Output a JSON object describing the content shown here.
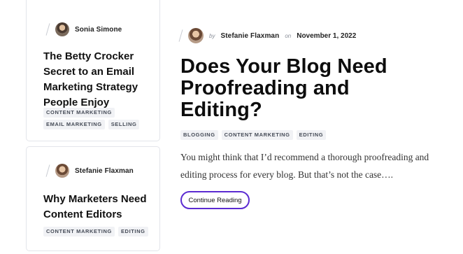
{
  "cards": [
    {
      "author": "Sonia Simone",
      "title": "The Betty Crocker Secret to an Email Marketing Strategy People Enjoy",
      "tags": [
        "Content Marketing",
        "Email Marketing",
        "Selling"
      ]
    },
    {
      "author": "Stefanie Flaxman",
      "title": "Why Marketers Need Content Editors",
      "tags": [
        "Content Marketing",
        "Editing"
      ]
    }
  ],
  "main": {
    "by_label": "by",
    "author": "Stefanie Flaxman",
    "on_label": "on",
    "date": "November 1, 2022",
    "title": "Does Your Blog Need Proofreading and Editing?",
    "tags": [
      "Blogging",
      "Content Marketing",
      "Editing"
    ],
    "excerpt": "You might think that I’d recommend a thorough proofreading and editing process for every blog. But that’s not the case….",
    "cta_label": "Continue Reading"
  },
  "colors": {
    "accent": "#5b2bd1",
    "tag_bg": "#f1f2f5",
    "border": "#e3e5ea"
  }
}
